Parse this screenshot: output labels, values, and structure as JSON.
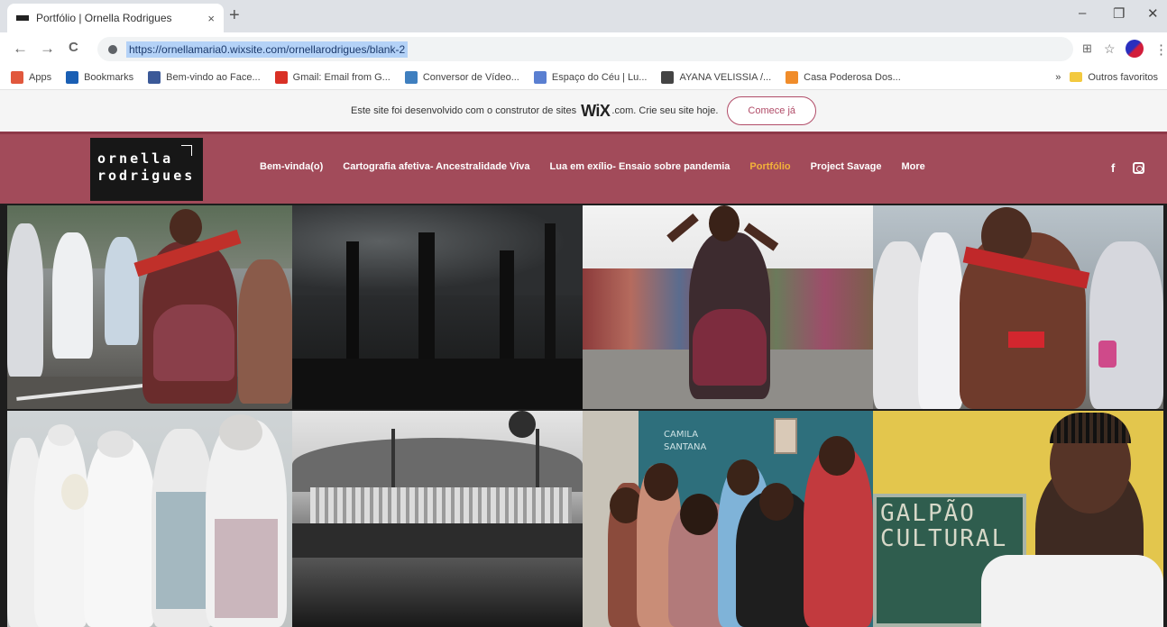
{
  "browser": {
    "tab_title": "Portfólio | Ornella Rodrigues",
    "tab_close": "×",
    "new_tab": "+",
    "url": "https://ornellamaria0.wixsite.com/ornellarodrigues/blank-2",
    "window_controls": {
      "minimize": "–",
      "maximize": "❐",
      "close": "✕"
    },
    "nav": {
      "back": "←",
      "forward": "→",
      "reload": "C"
    },
    "toolbar_icons": {
      "translate": "⊞",
      "star": "☆",
      "menu": "⋮"
    }
  },
  "bookmarks": {
    "items": [
      {
        "label": "Apps",
        "icon_color": "#e1583d"
      },
      {
        "label": "Bookmarks",
        "icon_color": "#1a5fb4"
      },
      {
        "label": "Bem-vindo ao Face...",
        "icon_color": "#3b5998"
      },
      {
        "label": "Gmail: Email from G...",
        "icon_color": "#d93025"
      },
      {
        "label": "Conversor de Vídeo...",
        "icon_color": "#3f7fbf"
      },
      {
        "label": "Espaço do Céu | Lu...",
        "icon_color": "#5a7fd1"
      },
      {
        "label": "AYANA VELISSIA /...",
        "icon_color": "#444444"
      },
      {
        "label": "Casa Poderosa Dos...",
        "icon_color": "#f08c2a"
      }
    ],
    "overflow": "»",
    "other": "Outros favoritos"
  },
  "wix_banner": {
    "text_before": "Este site foi desenvolvido com o construtor de sites",
    "logo": "WiX",
    "text_after": ".com. Crie seu site hoje.",
    "cta": "Comece já"
  },
  "site": {
    "logo_line1": "ornella",
    "logo_line2": "rodrigues",
    "nav": [
      "Bem-vinda(o)",
      "Cartografia afetiva- Ancestralidade Viva",
      "Lua em exílio- Ensaio sobre pandemia",
      "Portfólio",
      "Project Savage",
      "More"
    ],
    "active_nav": "Portfólio",
    "facebook": "f",
    "brand_color": "#a24b5a"
  },
  "gallery": {
    "photos": [
      {
        "name": "photo-dancer-street"
      },
      {
        "name": "photo-trees-silhouette"
      },
      {
        "name": "photo-dancer-crowd"
      },
      {
        "name": "photo-dancer-closeup"
      },
      {
        "name": "photo-baianas-procession"
      },
      {
        "name": "photo-historic-boat"
      },
      {
        "name": "photo-group-portrait",
        "text": "CAMILA SANTANA"
      },
      {
        "name": "photo-galpao-cultural",
        "text": "GALPÃO CULTURAL"
      }
    ]
  }
}
